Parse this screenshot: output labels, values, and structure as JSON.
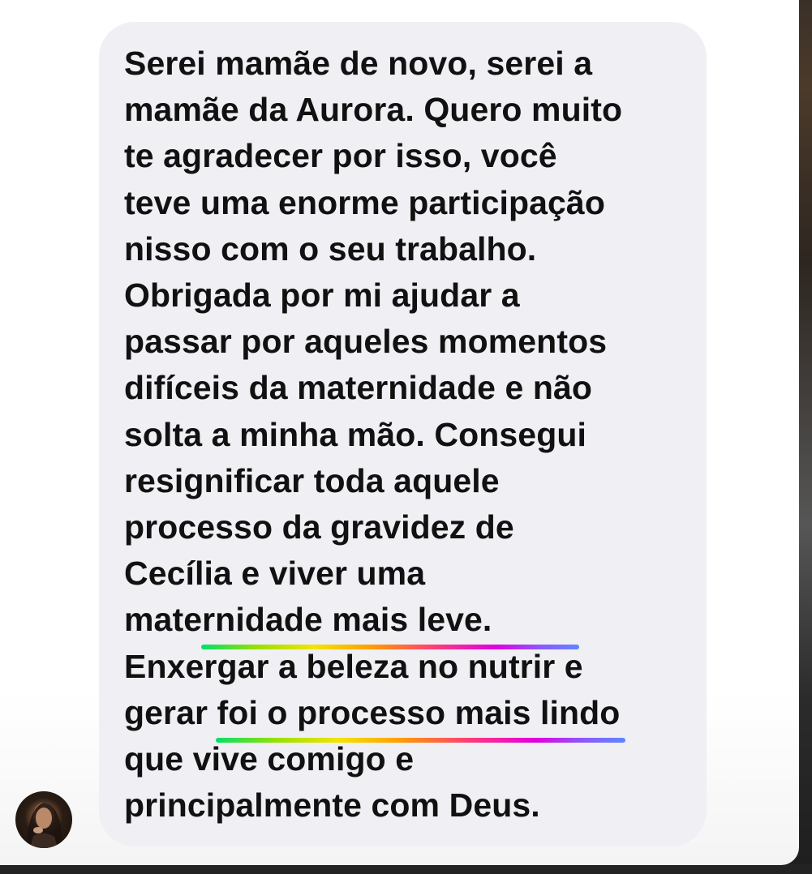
{
  "message": {
    "lines": [
      "Serei mamãe de novo, serei a",
      "mamãe da Aurora. Quero muito",
      "te agradecer por isso, você",
      "teve uma enorme participação",
      "nisso com o seu trabalho.",
      "Obrigada por mi ajudar a",
      "passar por aqueles momentos",
      "difíceis da maternidade e não",
      "solta a minha mão. Consegui",
      "resignificar toda aquele",
      "processo da gravidez de",
      "Cecília e viver uma",
      "maternidade mais leve.",
      "Enxergar a beleza no nutrir e",
      "gerar foi o processo mais lindo",
      "que vive comigo e",
      "principalmente com Deus."
    ]
  },
  "sender": {
    "avatar_icon": "user-avatar-photo"
  },
  "colors": {
    "bubble": "#efeff4",
    "text": "#111111",
    "highlight_gradient": [
      "#00e06a",
      "#f2e500",
      "#ff9d00",
      "#ff3b7a",
      "#e000e0",
      "#5f86ff"
    ]
  }
}
